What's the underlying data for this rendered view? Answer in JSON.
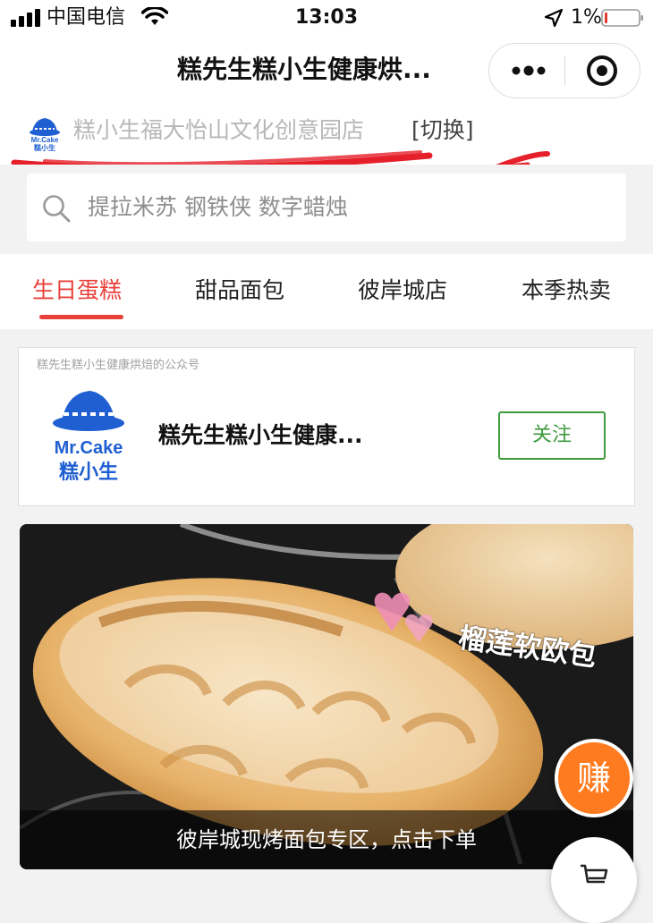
{
  "status_bar": {
    "carrier": "中国电信",
    "time": "13:03",
    "battery_percent": "1%",
    "battery_level": 0.01,
    "icons": [
      "signal-icon",
      "wifi-icon",
      "location-icon",
      "battery-icon"
    ]
  },
  "nav": {
    "title": "糕先生糕小生健康烘...",
    "menu_icon": "more-dots-icon",
    "close_icon": "close-circle-icon"
  },
  "store": {
    "name": "糕小生福大怡山文化创意园店",
    "switch_label": "[切换]",
    "logo_icon": "mr-cake-logo-icon"
  },
  "search": {
    "placeholder": "提拉米苏 钢铁侠 数字蜡烛",
    "icon": "search-icon"
  },
  "tabs": [
    {
      "label": "生日蛋糕",
      "active": true
    },
    {
      "label": "甜品面包",
      "active": false
    },
    {
      "label": "彼岸城店",
      "active": false
    },
    {
      "label": "本季热卖",
      "active": false
    }
  ],
  "official_account": {
    "caption": "糕先生糕小生健康烘焙的公众号",
    "name": "糕先生糕小生健康...",
    "follow_label": "关注",
    "logo_text_top": "Mr.Cake",
    "logo_text_bottom": "糕小生"
  },
  "banner": {
    "title": "榴莲软欧包",
    "caption": "彼岸城现烤面包专区，点击下单"
  },
  "floating": {
    "earn_label": "赚",
    "cart_icon": "cart-icon"
  },
  "colors": {
    "accent_red": "#e8413b",
    "follow_green": "#3d9a3d",
    "earn_orange": "#ff7b1f",
    "brand_blue": "#1f5fd1",
    "annotation_red": "#e5202b"
  }
}
